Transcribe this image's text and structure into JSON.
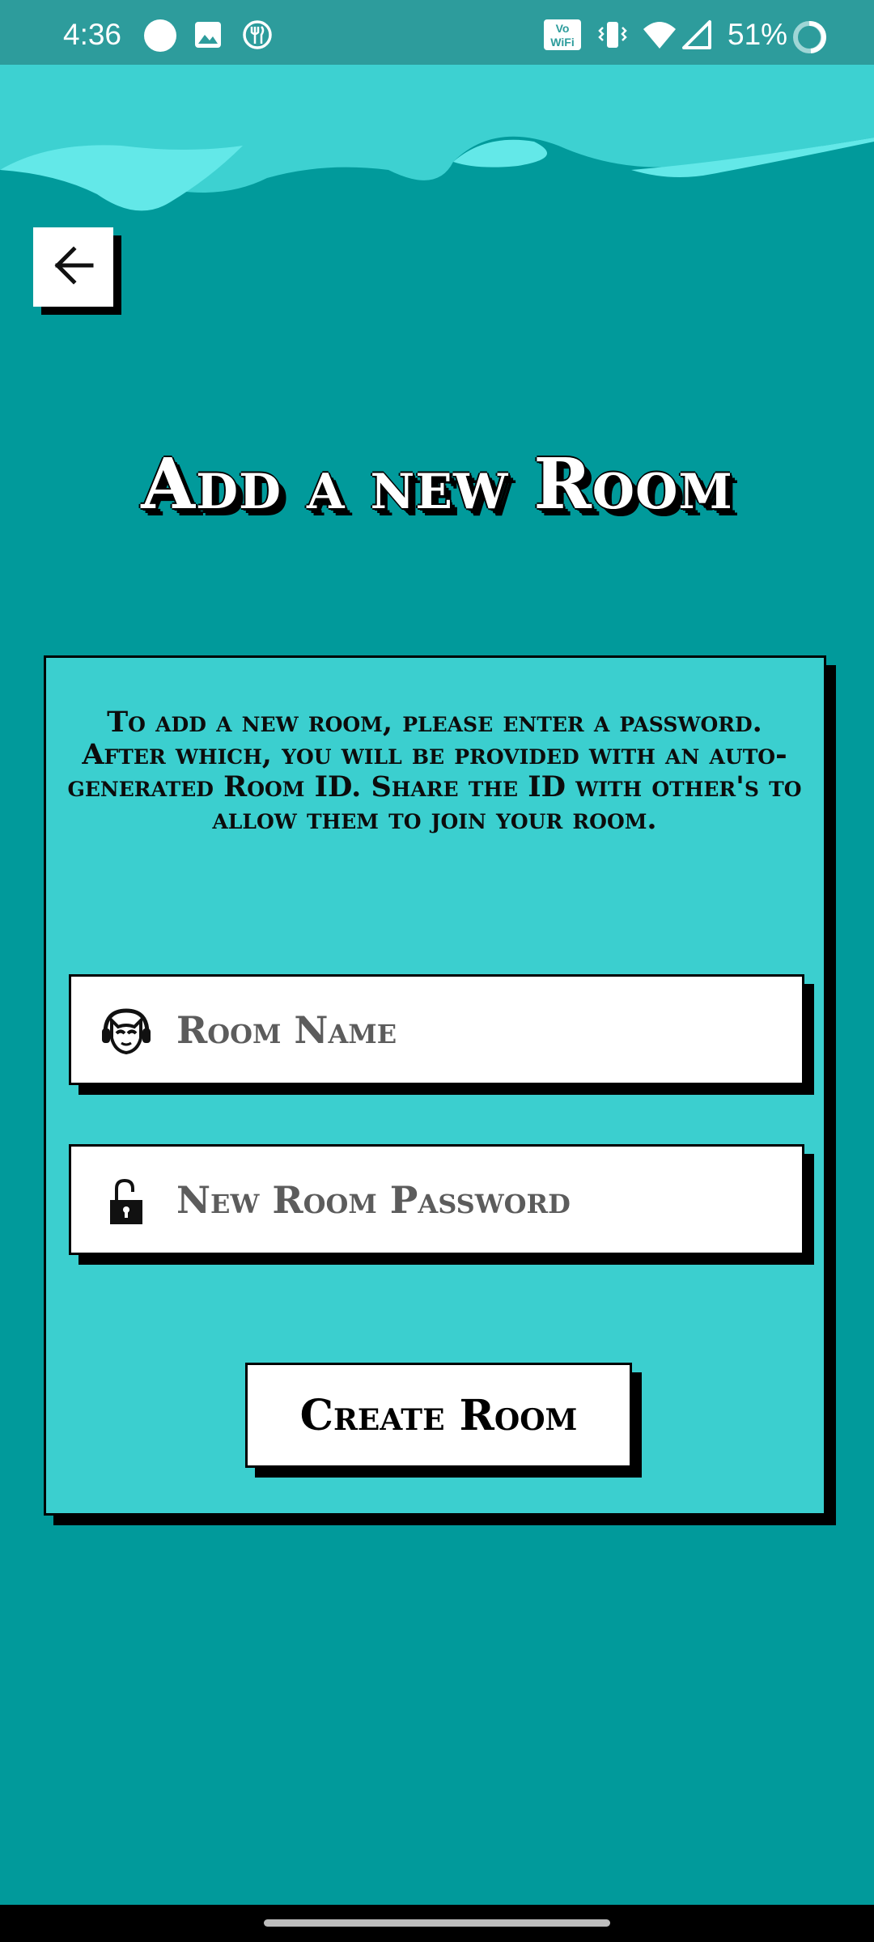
{
  "status_bar": {
    "time": "4:36",
    "battery_percent": "51%",
    "icons": [
      "circle-icon",
      "image-icon",
      "food-icon",
      "vowifi-icon",
      "vibrate-icon",
      "wifi-icon",
      "signal-icon",
      "battery-ring-icon"
    ],
    "vowifi_line1": "Vo",
    "vowifi_line2": "WiFi"
  },
  "colors": {
    "background": "#019a9b",
    "status_bar": "#2d9c9c",
    "card": "#3bcfcf",
    "wave_light": "#63e8e8",
    "wave_mid": "#3dd1d1",
    "field_text": "#5c5c5c"
  },
  "header": {
    "back_icon": "arrow-left-icon",
    "title": "Add a new Room"
  },
  "card": {
    "description": "To add a new room, please enter a password. After which, you will be provided with an auto-generated Room ID. Share the ID with other's to allow them to join your room.",
    "room_name": {
      "icon": "napster-cat-headphones-icon",
      "placeholder": "Room Name",
      "value": ""
    },
    "password": {
      "icon": "unlocked-padlock-icon",
      "placeholder": "New Room Password",
      "value": ""
    },
    "create_button_label": "Create Room"
  }
}
